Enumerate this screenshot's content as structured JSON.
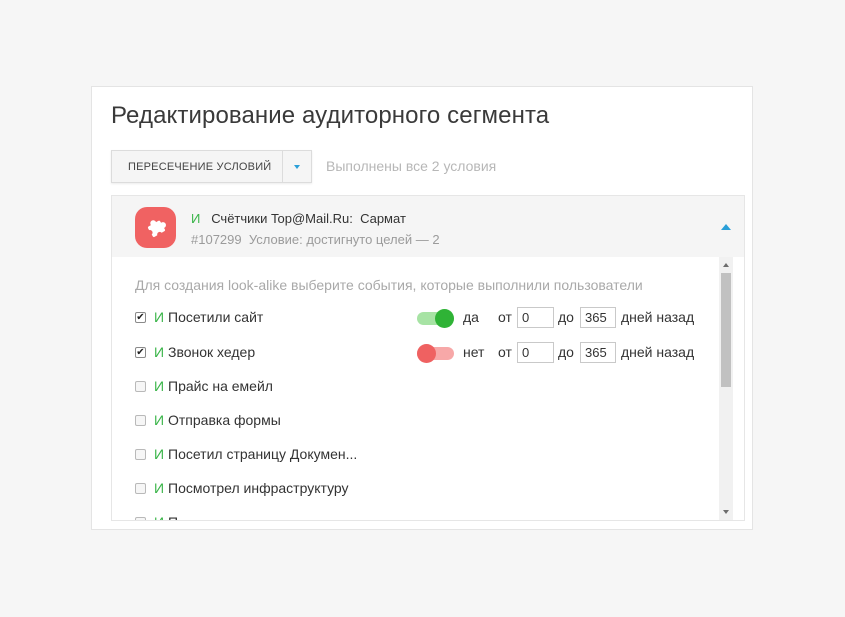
{
  "title": "Редактирование аудиторного сегмента",
  "dropdown": {
    "label": "ПЕРЕСЕЧЕНИЕ УСЛОВИЙ",
    "arrow_icon": "caret-down-icon"
  },
  "status_text": "Выполнены все 2 условия",
  "counter": {
    "icon": "puzzle-icon",
    "icon_color": "#f06262",
    "and_label": "И",
    "source_label": "Счётчики Top@Mail.Ru:",
    "name": "Сармат",
    "id": "#107299",
    "condition": "Условие: достигнуто целей — 2"
  },
  "hint": "Для создания look-alike выберите события, которые выполнили пользователи",
  "events": [
    {
      "checked": true,
      "and": "И",
      "label": "Посетили сайт",
      "toggle_on": true,
      "toggle_label": "да",
      "from_label": "от",
      "from": "0",
      "to_label": "до",
      "to": "365",
      "days_label": "дней назад"
    },
    {
      "checked": true,
      "and": "И",
      "label": "Звонок хедер",
      "toggle_on": false,
      "toggle_label": "нет",
      "from_label": "от",
      "from": "0",
      "to_label": "до",
      "to": "365",
      "days_label": "дней назад"
    },
    {
      "checked": false,
      "and": "И",
      "label": "Прайс на емейл"
    },
    {
      "checked": false,
      "and": "И",
      "label": "Отправка формы"
    },
    {
      "checked": false,
      "and": "И",
      "label": "Посетил страницу Докумен..."
    },
    {
      "checked": false,
      "and": "И",
      "label": "Посмотрел инфраструктуру"
    },
    {
      "checked": false,
      "and": "И",
      "label": "П"
    }
  ],
  "colors": {
    "accent_blue": "#2a9fd8",
    "green": "#3bb54a",
    "toggle_on": "#2fb336",
    "toggle_off": "#ef6161"
  }
}
